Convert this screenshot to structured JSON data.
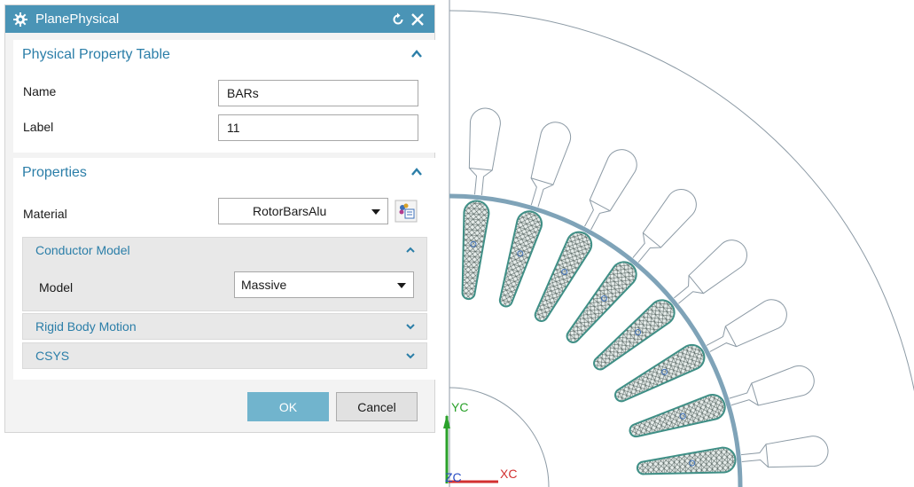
{
  "dialog": {
    "title": "PlanePhysical",
    "icons": {
      "settings": "gear-icon",
      "reset": "reset-icon",
      "close": "close-icon"
    }
  },
  "physical_property_table": {
    "header": "Physical Property Table",
    "name_label": "Name",
    "name_value": "BARs",
    "label_label": "Label",
    "label_value": "11"
  },
  "properties": {
    "header": "Properties",
    "material_label": "Material",
    "material_value": "RotorBarsAlu",
    "conductor_model": {
      "header": "Conductor Model",
      "model_label": "Model",
      "model_value": "Massive"
    },
    "rigid_body_motion": {
      "header": "Rigid Body Motion"
    },
    "csys": {
      "header": "CSYS"
    }
  },
  "buttons": {
    "ok": "OK",
    "cancel": "Cancel"
  },
  "viewport": {
    "axes": {
      "y": "YC",
      "x": "XC",
      "z": "ZC"
    },
    "colors": {
      "accent": "#4a94b6",
      "mesh": "#3f8f86",
      "ring": "#7fa3b8",
      "outline": "#8c9aa5"
    }
  }
}
